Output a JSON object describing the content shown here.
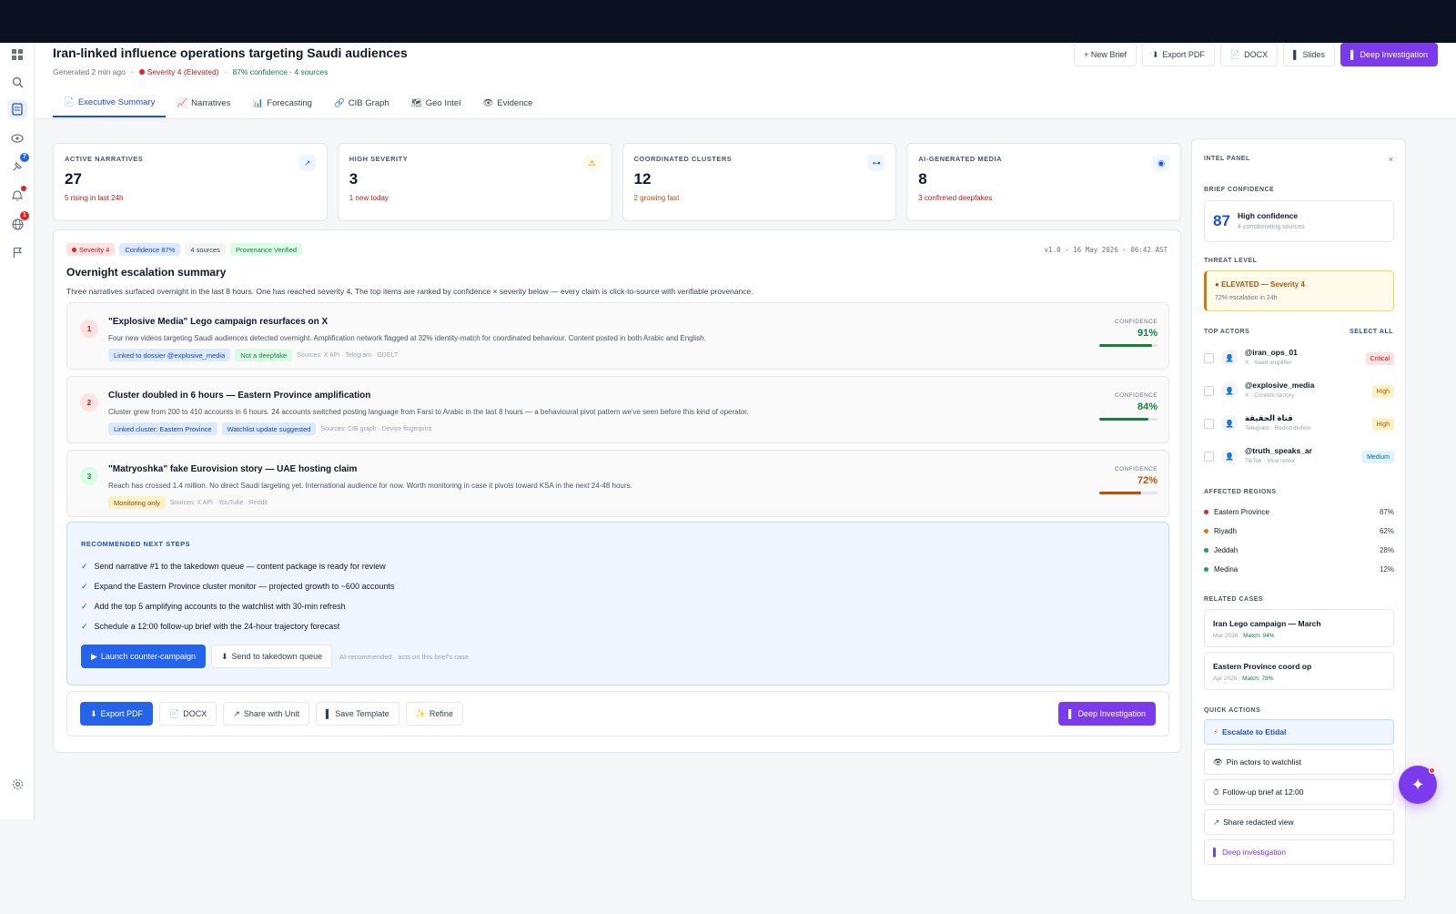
{
  "header": {
    "title": "Iran-linked influence operations targeting Saudi audiences",
    "generated": "Generated 2 min ago",
    "severity": "Severity 4 (Elevated)",
    "confidence": "87% confidence · 4 sources",
    "buttons": {
      "new_brief": "+ New Brief",
      "export_pdf": "Export PDF",
      "docx": "DOCX",
      "slides": "Slides",
      "deep": "Deep Investigation"
    }
  },
  "tabs": [
    {
      "label": "Executive Summary",
      "icon": "📄"
    },
    {
      "label": "Narratives",
      "icon": "📈"
    },
    {
      "label": "Forecasting",
      "icon": "📊"
    },
    {
      "label": "CIB Graph",
      "icon": "🔗"
    },
    {
      "label": "Geo Intel",
      "icon": "🗺"
    },
    {
      "label": "Evidence",
      "icon": "👁"
    }
  ],
  "rail_badges": {
    "pin": "7",
    "globe": "1"
  },
  "kpis": [
    {
      "label": "Active Narratives",
      "value": "27",
      "sub": "5 rising in last 24h",
      "sub_color": "#b91c1c",
      "icon": "↗",
      "icon_name": "trend-icon"
    },
    {
      "label": "High Severity",
      "value": "3",
      "sub": "1 new today",
      "sub_color": "#b91c1c",
      "icon": "⚠",
      "icon_name": "warning-icon"
    },
    {
      "label": "Coordinated Clusters",
      "value": "12",
      "sub": "2 growing fast",
      "sub_color": "#b45309",
      "icon": "⊶",
      "icon_name": "link-icon"
    },
    {
      "label": "AI-Generated Media",
      "value": "8",
      "sub": "3 confirmed deepfakes",
      "sub_color": "#b91c1c",
      "icon": "◉",
      "icon_name": "target-icon"
    }
  ],
  "brief": {
    "chips": {
      "severity": "Severity 4",
      "confidence": "Confidence 87%",
      "sources": "4 sources",
      "provenance": "Provenance Verified"
    },
    "version": "v1.0 · 16 May 2026 · 06:42 AST",
    "title": "Overnight escalation summary",
    "desc": "Three narratives surfaced overnight in the last 8 hours. One has reached severity 4. The top items are ranked by confidence × severity below — every claim is click-to-source with verifiable provenance.",
    "items": [
      {
        "num": "1",
        "title": "\"Explosive Media\" Lego campaign resurfaces on X",
        "desc": "Four new videos targeting Saudi audiences detected overnight. Amplification network flagged at 32% identity-match for coordinated behaviour. Content posted in both Arabic and English.",
        "tags": [
          "Linked to dossier @explosive_media",
          "Not a deepfake"
        ],
        "sources": "Sources: X API · Telegram · GDELT",
        "conf_label": "CONFIDENCE",
        "conf": "91%",
        "conf_value": 0.91,
        "color": "#15803d"
      },
      {
        "num": "2",
        "title": "Cluster doubled in 6 hours — Eastern Province amplification",
        "desc": "Cluster grew from 200 to 410 accounts in 6 hours. 24 accounts switched posting language from Farsi to Arabic in the last 8 hours — a behavioural pivot pattern we've seen before this kind of operator.",
        "tags": [
          "Linked cluster: Eastern Province",
          "Watchlist update suggested"
        ],
        "sources": "Sources: CIB graph · Device fingerprint",
        "conf_label": "CONFIDENCE",
        "conf": "84%",
        "conf_value": 0.84,
        "color": "#15803d"
      },
      {
        "num": "3",
        "title": "\"Matryoshka\" fake Eurovision story — UAE hosting claim",
        "desc": "Reach has crossed 1.4 million. No direct Saudi targeting yet. International audience for now. Worth monitoring in case it pivots toward KSA in the next 24-48 hours.",
        "tags": [
          "Monitoring only"
        ],
        "sources": "Sources: X API · YouTube · Reddit",
        "conf_label": "CONFIDENCE",
        "conf": "72%",
        "conf_value": 0.72,
        "color": "#b45309"
      }
    ],
    "rec": {
      "label": "RECOMMENDED NEXT STEPS",
      "steps": [
        "Send narrative #1 to the takedown queue — content package is ready for review",
        "Expand the Eastern Province cluster monitor — projected growth to ~600 accounts",
        "Add the top 5 amplifying accounts to the watchlist with 30-min refresh",
        "Schedule a 12:00 follow-up brief with the 24-hour trajectory forecast"
      ],
      "launch": "Launch counter-campaign",
      "takedown": "Send to takedown queue",
      "note": "AI-recommended · acts on this brief's case"
    },
    "footer": {
      "export": "Export PDF",
      "docx": "DOCX",
      "share": "Share with Unit",
      "template": "Save Template",
      "refine": "Refine",
      "deep": "Deep Investigation"
    }
  },
  "panel": {
    "title": "INTEL PANEL",
    "close": "×",
    "confidence_label": "BRIEF CONFIDENCE",
    "confidence_value": "87",
    "confidence_text": "High confidence",
    "confidence_sub": "4 corroborating sources",
    "threat_label": "THREAT LEVEL",
    "threat_title": "ELEVATED — Severity 4",
    "threat_sub": "72% escalation in 24h",
    "actors_label": "TOP ACTORS",
    "select_all": "SELECT ALL",
    "actors": [
      {
        "name": "@iran_ops_01",
        "sub": "X · Seed amplifier",
        "badge": "Critical",
        "bg": "#fee2e2",
        "fg": "#b91c1c"
      },
      {
        "name": "@explosive_media",
        "sub": "X · Content factory",
        "badge": "High",
        "bg": "#fef3c7",
        "fg": "#b45309"
      },
      {
        "name": "قناة الحقيقة",
        "sub": "Telegram · Redistribution",
        "badge": "High",
        "bg": "#fef3c7",
        "fg": "#b45309"
      },
      {
        "name": "@truth_speaks_ar",
        "sub": "TikTok · Viral remix",
        "badge": "Medium",
        "bg": "#e0f2fe",
        "fg": "#0369a1"
      }
    ],
    "regions_label": "AFFECTED REGIONS",
    "regions": [
      {
        "name": "Eastern Province",
        "pct": "87%",
        "color": "#dc2626"
      },
      {
        "name": "Riyadh",
        "pct": "62%",
        "color": "#d97706"
      },
      {
        "name": "Jeddah",
        "pct": "28%",
        "color": "#16a34a"
      },
      {
        "name": "Medina",
        "pct": "12%",
        "color": "#16a34a"
      }
    ],
    "cases_label": "RELATED CASES",
    "cases": [
      {
        "title": "Iran Lego campaign — March",
        "date": "Mar 2026",
        "match": "Match: 94%"
      },
      {
        "title": "Eastern Province coord op",
        "date": "Apr 2026",
        "match": "Match: 78%"
      }
    ],
    "qa_label": "QUICK ACTIONS",
    "actions": [
      {
        "label": "Escalate to Etidal",
        "icon": "⚡"
      },
      {
        "label": "Pin actors to watchlist",
        "icon": "👁"
      },
      {
        "label": "Follow-up brief at 12:00",
        "icon": "⏱"
      },
      {
        "label": "Share redacted view",
        "icon": "↗"
      },
      {
        "label": "Deep investigation",
        "icon": "▌"
      }
    ]
  }
}
